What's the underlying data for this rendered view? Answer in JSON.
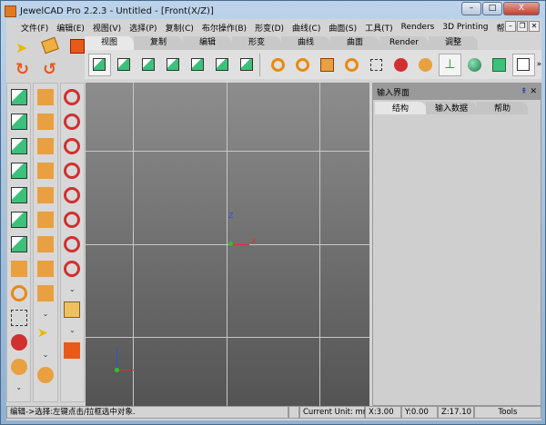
{
  "window": {
    "title": "JewelCAD Pro 2.2.3 - Untitled - [Front(X/Z)]",
    "minimize": "–",
    "maximize": "□",
    "close": "X"
  },
  "menu": [
    "文件(F)",
    "编辑(E)",
    "视图(V)",
    "选择(P)",
    "复制(C)",
    "布尔操作(B)",
    "形变(D)",
    "曲线(C)",
    "曲面(S)",
    "工具(T)",
    "Renders",
    "3D Printing",
    "帮助(H)"
  ],
  "mdi": [
    "–",
    "❐",
    "✕"
  ],
  "tabs": [
    "视图",
    "复制",
    "编辑",
    "形变",
    "曲线",
    "曲面",
    "Render",
    "调整"
  ],
  "active_tab": "视图",
  "toolbar_icons": [
    "cube-view-icon",
    "cube-front-icon",
    "cube-top-icon",
    "cube-bottom-icon",
    "cube-side-icon",
    "cube-right-icon",
    "cube-iso-icon",
    "zoom-in-icon",
    "zoom-out-icon",
    "zoom-fit-icon",
    "rotate-view-icon",
    "zoom-window-icon",
    "orbit-icon",
    "pan-icon",
    "axis-icon",
    "sphere-shade-icon",
    "solid-cube-icon",
    "wire-cube-icon"
  ],
  "toolbar_more": "»",
  "panel": {
    "title": "输入界面",
    "pin": "⇞",
    "close": "✕",
    "tabs": [
      "结构",
      "输入数据",
      "帮助"
    ],
    "active_tab": "结构"
  },
  "viewport": {
    "axis_z": "Z",
    "axis_x": "X"
  },
  "more": "⌄",
  "status": {
    "message": "编辑->选择:左键点击/拉框选中对象.",
    "unit": "Current Unit:  mm",
    "x": "X:3.00",
    "y": "Y:0.00",
    "z": "Z:17.10",
    "tools": "Tools"
  },
  "colors": {
    "accent_green": "#3cc07a",
    "accent_orange": "#e8781e",
    "grid": "#c8c8c8"
  }
}
